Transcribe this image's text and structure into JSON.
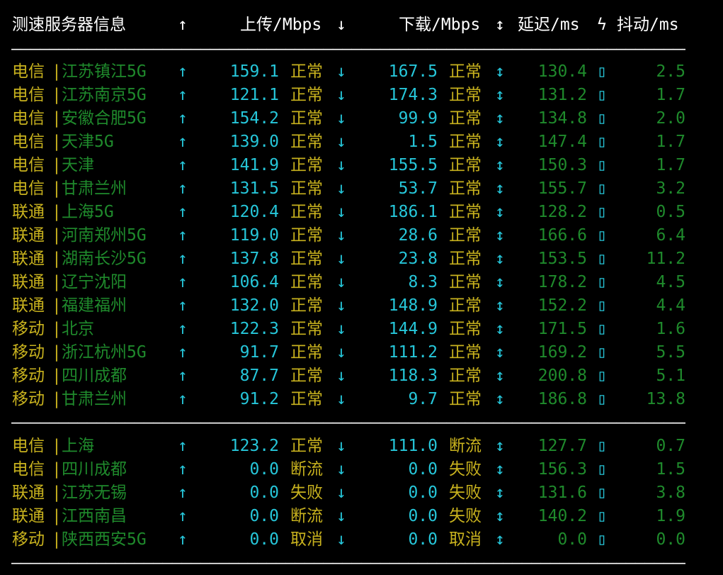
{
  "header": {
    "server": "测速服务器信息",
    "up_arrow": "↑",
    "upload": "上传/Mbps",
    "down_arrow": "↓",
    "download": "下载/Mbps",
    "updown_arrow": "↕",
    "latency": "延迟/ms",
    "bolt": "ϟ",
    "jitter": "抖动/ms"
  },
  "separator": "———————————————————————————————————————————————————————————————————————————————",
  "glyphs": {
    "up": "↑",
    "down": "↓",
    "updown": "↕",
    "box": "▯",
    "bar": "|"
  },
  "colors": {
    "isp": "#c8b21e",
    "city": "#1f8a2c",
    "cyan": "#26c6d9",
    "background": "#000000"
  },
  "group1": [
    {
      "isp": "电信",
      "city": "江苏镇江5G",
      "up": "159.1",
      "up_status": "正常",
      "down": "167.5",
      "down_status": "正常",
      "latency": "130.4",
      "jitter": "2.5"
    },
    {
      "isp": "电信",
      "city": "江苏南京5G",
      "up": "121.1",
      "up_status": "正常",
      "down": "174.3",
      "down_status": "正常",
      "latency": "131.2",
      "jitter": "1.7"
    },
    {
      "isp": "电信",
      "city": "安徽合肥5G",
      "up": "154.2",
      "up_status": "正常",
      "down": "99.9",
      "down_status": "正常",
      "latency": "134.8",
      "jitter": "2.0"
    },
    {
      "isp": "电信",
      "city": "天津5G",
      "up": "139.0",
      "up_status": "正常",
      "down": "1.5",
      "down_status": "正常",
      "latency": "147.4",
      "jitter": "1.7"
    },
    {
      "isp": "电信",
      "city": "天津",
      "up": "141.9",
      "up_status": "正常",
      "down": "155.5",
      "down_status": "正常",
      "latency": "150.3",
      "jitter": "1.7"
    },
    {
      "isp": "电信",
      "city": "甘肃兰州",
      "up": "131.5",
      "up_status": "正常",
      "down": "53.7",
      "down_status": "正常",
      "latency": "155.7",
      "jitter": "3.2"
    },
    {
      "isp": "联通",
      "city": "上海5G",
      "up": "120.4",
      "up_status": "正常",
      "down": "186.1",
      "down_status": "正常",
      "latency": "128.2",
      "jitter": "0.5"
    },
    {
      "isp": "联通",
      "city": "河南郑州5G",
      "up": "119.0",
      "up_status": "正常",
      "down": "28.6",
      "down_status": "正常",
      "latency": "166.6",
      "jitter": "6.4"
    },
    {
      "isp": "联通",
      "city": "湖南长沙5G",
      "up": "137.8",
      "up_status": "正常",
      "down": "23.8",
      "down_status": "正常",
      "latency": "153.5",
      "jitter": "11.2"
    },
    {
      "isp": "联通",
      "city": "辽宁沈阳",
      "up": "106.4",
      "up_status": "正常",
      "down": "8.3",
      "down_status": "正常",
      "latency": "178.2",
      "jitter": "4.5"
    },
    {
      "isp": "联通",
      "city": "福建福州",
      "up": "132.0",
      "up_status": "正常",
      "down": "148.9",
      "down_status": "正常",
      "latency": "152.2",
      "jitter": "4.4"
    },
    {
      "isp": "移动",
      "city": "北京",
      "up": "122.3",
      "up_status": "正常",
      "down": "144.9",
      "down_status": "正常",
      "latency": "171.5",
      "jitter": "1.6"
    },
    {
      "isp": "移动",
      "city": "浙江杭州5G",
      "up": "91.7",
      "up_status": "正常",
      "down": "111.2",
      "down_status": "正常",
      "latency": "169.2",
      "jitter": "5.5"
    },
    {
      "isp": "移动",
      "city": "四川成都",
      "up": "87.7",
      "up_status": "正常",
      "down": "118.3",
      "down_status": "正常",
      "latency": "200.8",
      "jitter": "5.1"
    },
    {
      "isp": "移动",
      "city": "甘肃兰州",
      "up": "91.2",
      "up_status": "正常",
      "down": "9.7",
      "down_status": "正常",
      "latency": "186.8",
      "jitter": "13.8"
    }
  ],
  "group2": [
    {
      "isp": "电信",
      "city": "上海",
      "up": "123.2",
      "up_status": "正常",
      "down": "111.0",
      "down_status": "断流",
      "latency": "127.7",
      "jitter": "0.7"
    },
    {
      "isp": "电信",
      "city": "四川成都",
      "up": "0.0",
      "up_status": "断流",
      "down": "0.0",
      "down_status": "失败",
      "latency": "156.3",
      "jitter": "1.5"
    },
    {
      "isp": "联通",
      "city": "江苏无锡",
      "up": "0.0",
      "up_status": "失败",
      "down": "0.0",
      "down_status": "失败",
      "latency": "131.6",
      "jitter": "3.8"
    },
    {
      "isp": "联通",
      "city": "江西南昌",
      "up": "0.0",
      "up_status": "断流",
      "down": "0.0",
      "down_status": "失败",
      "latency": "140.2",
      "jitter": "1.9"
    },
    {
      "isp": "移动",
      "city": "陕西西安5G",
      "up": "0.0",
      "up_status": "取消",
      "down": "0.0",
      "down_status": "取消",
      "latency": "0.0",
      "jitter": "0.0"
    }
  ]
}
